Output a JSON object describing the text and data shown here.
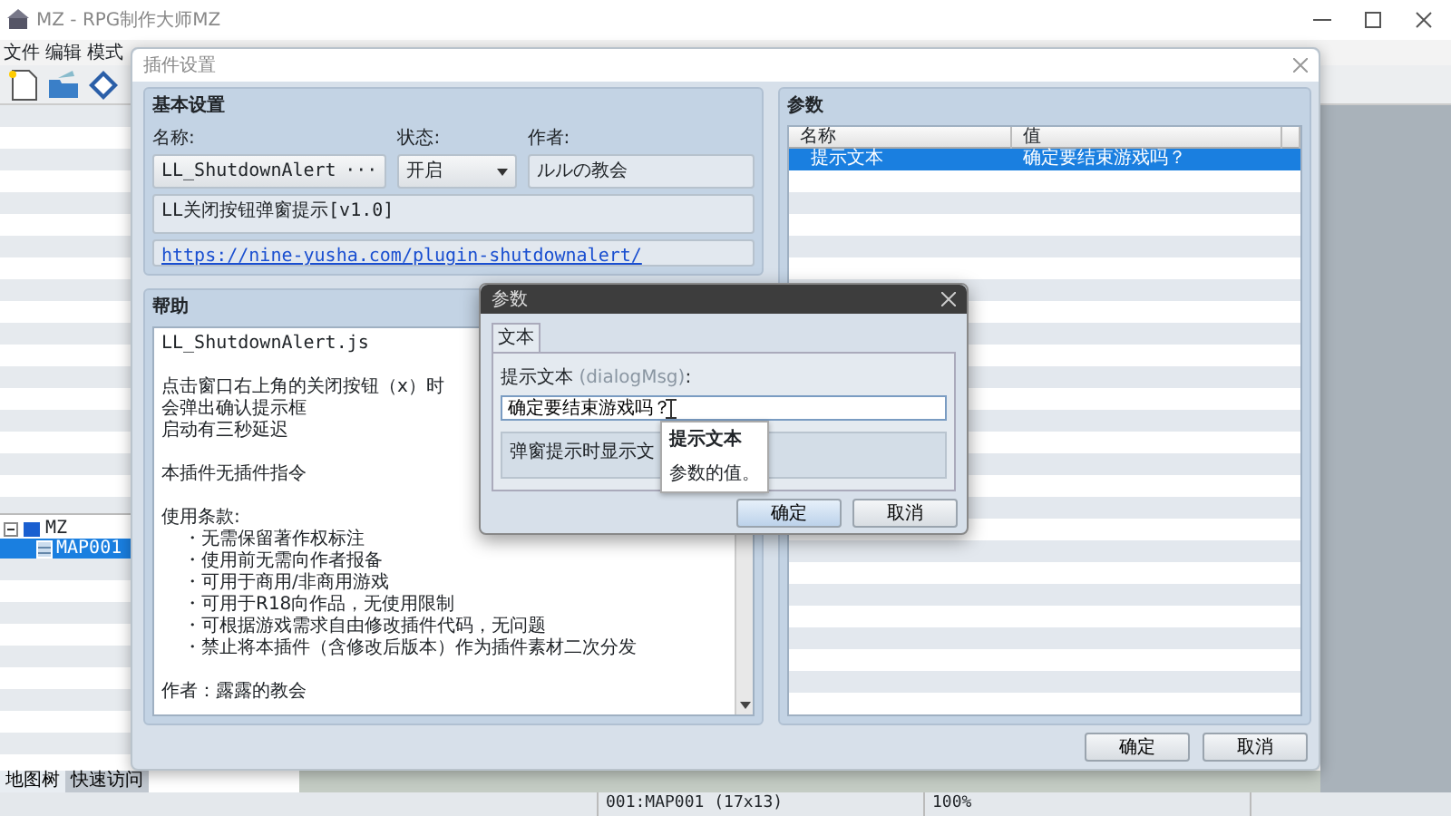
{
  "app": {
    "title": "MZ - RPG制作大师MZ",
    "menu": [
      "文件",
      "编辑",
      "模式"
    ]
  },
  "map_tree": [
    {
      "label": "MZ",
      "expanded": true,
      "selected": false,
      "children": [
        {
          "label": "MAP001",
          "selected": true
        }
      ]
    }
  ],
  "left_tabs": [
    {
      "label": "地图树",
      "selected": true
    },
    {
      "label": "快速访问",
      "selected": false
    }
  ],
  "status_bar": [
    "001:MAP001 (17x13)",
    "100%"
  ],
  "plugin_dialog": {
    "title": "插件设置",
    "basic": {
      "heading": "基本设置",
      "name_label": "名称:",
      "name": "LL_ShutdownAlert",
      "name_button": "···",
      "status_label": "状态:",
      "status": "开启",
      "author_label": "作者:",
      "author": "ルルの教会",
      "description": "LL关闭按钮弹窗提示[v1.0]",
      "url": "https://nine-yusha.com/plugin-shutdownalert/"
    },
    "params": {
      "heading": "参数",
      "columns": [
        "名称",
        "值"
      ],
      "rows": [
        {
          "name": "提示文本",
          "value": "确定要结束游戏吗？",
          "selected": true
        }
      ]
    },
    "help": {
      "heading": "帮助",
      "paragraphs": [
        [
          {
            "kind": "line",
            "text": "LL_ShutdownAlert.js"
          }
        ],
        [
          {
            "kind": "line",
            "text": "点击窗口右上角的关闭按钮（x）时"
          },
          {
            "kind": "line",
            "text": "会弹出确认提示框"
          },
          {
            "kind": "line",
            "text": "启动有三秒延迟"
          }
        ],
        [
          {
            "kind": "line",
            "text": "本插件无插件指令"
          }
        ],
        [
          {
            "kind": "line",
            "text": "使用条款:"
          },
          {
            "kind": "bullet",
            "text": "・无需保留著作权标注"
          },
          {
            "kind": "bullet",
            "text": "・使用前无需向作者报备"
          },
          {
            "kind": "bullet",
            "text": "・可用于商用/非商用游戏"
          },
          {
            "kind": "bullet",
            "text": "・可用于R18向作品，无使用限制"
          },
          {
            "kind": "bullet",
            "text": "・可根据游戏需求自由修改插件代码，无问题"
          },
          {
            "kind": "bullet",
            "text": "・禁止将本插件（含修改后版本）作为插件素材二次分发"
          }
        ],
        [
          {
            "kind": "line",
            "text": "作者：露露的教会"
          }
        ]
      ]
    },
    "buttons": [
      "确定",
      "取消"
    ]
  },
  "param_dialog": {
    "title": "参数",
    "tabs": [
      {
        "label": "文本",
        "selected": true
      }
    ],
    "field": {
      "label": "提示文本 ",
      "key": "(dialogMsg)",
      "suffix": ":",
      "value": "确定要结束游戏吗？"
    },
    "description": "弹窗提示时显示文",
    "tooltip": {
      "title": "提示文本",
      "text": "参数的值。"
    },
    "buttons": [
      "确定",
      "取消"
    ]
  }
}
